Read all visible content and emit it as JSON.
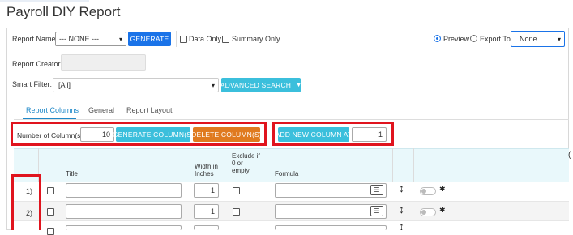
{
  "page": {
    "title": "Payroll DIY Report"
  },
  "report": {
    "name_label": "Report Name:",
    "name_value": "--- NONE ---",
    "generate_label": "GENERATE",
    "data_only_label": "Data Only",
    "summary_only_label": "Summary Only",
    "preview_label": "Preview",
    "export_to_label": "Export To",
    "export_value": "None",
    "creator_label": "Report Creator:",
    "smart_filter_label": "Smart Filter:",
    "smart_filter_value": "[All]",
    "advanced_search_label": "ADVANCED SEARCH"
  },
  "tabs": [
    {
      "label": "Report Columns",
      "active": true
    },
    {
      "label": "General",
      "active": false
    },
    {
      "label": "Report Layout",
      "active": false
    }
  ],
  "columns_toolbar": {
    "num_label": "Number of Column(s):",
    "num_value": "10",
    "generate_columns_label": "GENERATE COLUMN(S)",
    "delete_columns_label": "DELETE COLUMN(S)",
    "add_new_label": "ADD NEW COLUMN AT",
    "add_new_value": "1"
  },
  "table": {
    "headers": {
      "title": "Title",
      "width": [
        "Width in",
        "Inches"
      ],
      "exclude": [
        "Exclude if",
        "0 or",
        "empty"
      ],
      "formula": "Formula"
    },
    "rows": [
      {
        "index": "1)",
        "width": "1"
      },
      {
        "index": "2)",
        "width": "1"
      }
    ]
  },
  "colors": {
    "primary": "#1a73e8",
    "cyan": "#3bbfdc",
    "orange": "#e07a1f",
    "highlight_red": "#e0141e",
    "header_bg": "#e9f8fb"
  },
  "icons": {
    "select_chevron": "chevron-down-icon",
    "advanced_caret": "caret-down-icon",
    "formula_list": "list-icon",
    "reorder": "up-down-arrow-icon",
    "settings": "gear-icon"
  }
}
